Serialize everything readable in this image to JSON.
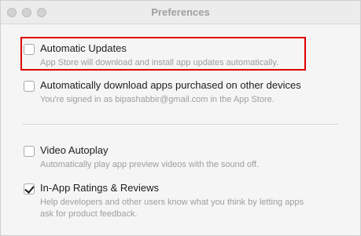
{
  "window": {
    "title": "Preferences"
  },
  "options": {
    "auto_updates": {
      "label": "Automatic Updates",
      "desc": "App Store will download and install app updates automatically.",
      "checked": false
    },
    "auto_download": {
      "label": "Automatically download apps purchased on other devices",
      "desc": "You're signed in as bipashabbir@gmail.com in the App Store.",
      "checked": false
    },
    "video_autoplay": {
      "label": "Video Autoplay",
      "desc": "Automatically play app preview videos with the sound off.",
      "checked": false
    },
    "ratings": {
      "label": "In-App Ratings & Reviews",
      "desc_line1": "Help developers and other users know what you think by letting apps",
      "desc_line2": "ask for product feedback.",
      "checked": true
    }
  },
  "colors": {
    "highlight": "#e00000",
    "description": "#9e9e9e"
  }
}
